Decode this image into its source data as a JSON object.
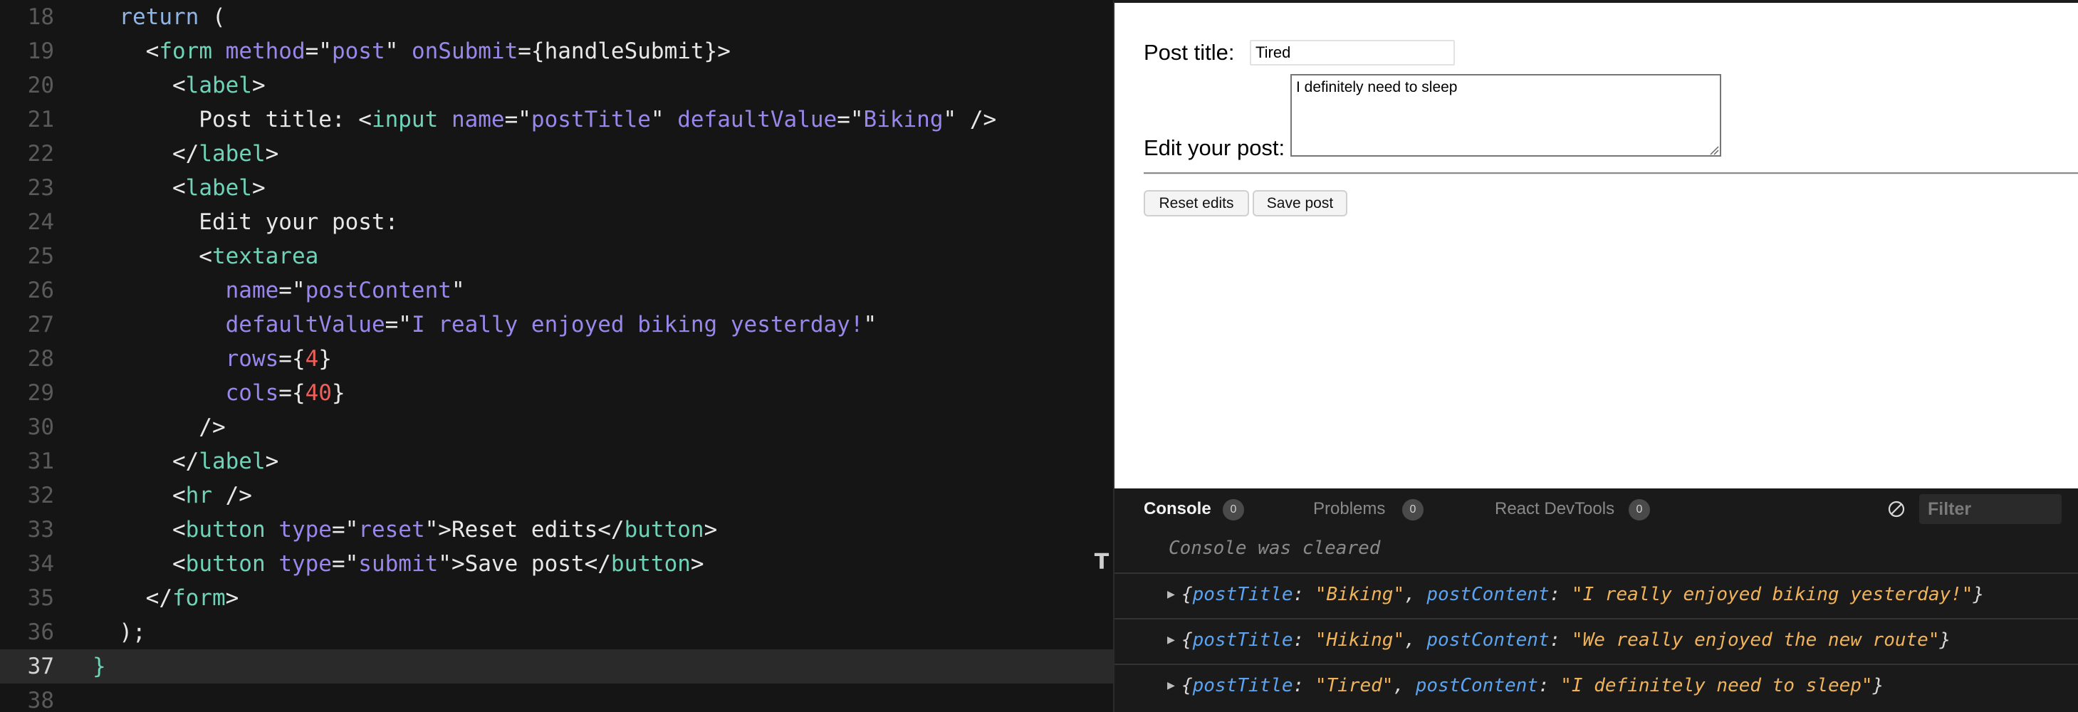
{
  "editor": {
    "lines": [
      {
        "num": "18",
        "tokens": [
          {
            "t": "  ",
            "c": "t-text"
          },
          {
            "t": "return",
            "c": "t-kw"
          },
          {
            "t": " (",
            "c": "t-punc"
          }
        ]
      },
      {
        "num": "19",
        "tokens": [
          {
            "t": "    <",
            "c": "t-punc"
          },
          {
            "t": "form",
            "c": "t-tag"
          },
          {
            "t": " ",
            "c": "t-text"
          },
          {
            "t": "method",
            "c": "t-attr"
          },
          {
            "t": "=\"",
            "c": "t-punc"
          },
          {
            "t": "post",
            "c": "t-str"
          },
          {
            "t": "\" ",
            "c": "t-punc"
          },
          {
            "t": "onSubmit",
            "c": "t-attr"
          },
          {
            "t": "={handleSubmit}>",
            "c": "t-punc"
          }
        ]
      },
      {
        "num": "20",
        "tokens": [
          {
            "t": "      <",
            "c": "t-punc"
          },
          {
            "t": "label",
            "c": "t-tag"
          },
          {
            "t": ">",
            "c": "t-punc"
          }
        ]
      },
      {
        "num": "21",
        "tokens": [
          {
            "t": "        Post title: <",
            "c": "t-text"
          },
          {
            "t": "input",
            "c": "t-tag"
          },
          {
            "t": " ",
            "c": "t-text"
          },
          {
            "t": "name",
            "c": "t-attr"
          },
          {
            "t": "=\"",
            "c": "t-punc"
          },
          {
            "t": "postTitle",
            "c": "t-str"
          },
          {
            "t": "\" ",
            "c": "t-punc"
          },
          {
            "t": "defaultValue",
            "c": "t-attr"
          },
          {
            "t": "=\"",
            "c": "t-punc"
          },
          {
            "t": "Biking",
            "c": "t-str"
          },
          {
            "t": "\" />",
            "c": "t-punc"
          }
        ]
      },
      {
        "num": "22",
        "tokens": [
          {
            "t": "      </",
            "c": "t-punc"
          },
          {
            "t": "label",
            "c": "t-tag"
          },
          {
            "t": ">",
            "c": "t-punc"
          }
        ]
      },
      {
        "num": "23",
        "tokens": [
          {
            "t": "      <",
            "c": "t-punc"
          },
          {
            "t": "label",
            "c": "t-tag"
          },
          {
            "t": ">",
            "c": "t-punc"
          }
        ]
      },
      {
        "num": "24",
        "tokens": [
          {
            "t": "        Edit your post:",
            "c": "t-text"
          }
        ]
      },
      {
        "num": "25",
        "tokens": [
          {
            "t": "        <",
            "c": "t-punc"
          },
          {
            "t": "textarea",
            "c": "t-tag"
          }
        ]
      },
      {
        "num": "26",
        "tokens": [
          {
            "t": "          ",
            "c": "t-text"
          },
          {
            "t": "name",
            "c": "t-attr"
          },
          {
            "t": "=\"",
            "c": "t-punc"
          },
          {
            "t": "postContent",
            "c": "t-str"
          },
          {
            "t": "\"",
            "c": "t-punc"
          }
        ]
      },
      {
        "num": "27",
        "tokens": [
          {
            "t": "          ",
            "c": "t-text"
          },
          {
            "t": "defaultValue",
            "c": "t-attr"
          },
          {
            "t": "=\"",
            "c": "t-punc"
          },
          {
            "t": "I really enjoyed biking yesterday!",
            "c": "t-str"
          },
          {
            "t": "\"",
            "c": "t-punc"
          }
        ]
      },
      {
        "num": "28",
        "tokens": [
          {
            "t": "          ",
            "c": "t-text"
          },
          {
            "t": "rows",
            "c": "t-attr"
          },
          {
            "t": "={",
            "c": "t-punc"
          },
          {
            "t": "4",
            "c": "t-num"
          },
          {
            "t": "}",
            "c": "t-punc"
          }
        ]
      },
      {
        "num": "29",
        "tokens": [
          {
            "t": "          ",
            "c": "t-text"
          },
          {
            "t": "cols",
            "c": "t-attr"
          },
          {
            "t": "={",
            "c": "t-punc"
          },
          {
            "t": "40",
            "c": "t-num"
          },
          {
            "t": "}",
            "c": "t-punc"
          }
        ]
      },
      {
        "num": "30",
        "tokens": [
          {
            "t": "        />",
            "c": "t-punc"
          }
        ]
      },
      {
        "num": "31",
        "tokens": [
          {
            "t": "      </",
            "c": "t-punc"
          },
          {
            "t": "label",
            "c": "t-tag"
          },
          {
            "t": ">",
            "c": "t-punc"
          }
        ]
      },
      {
        "num": "32",
        "tokens": [
          {
            "t": "      <",
            "c": "t-punc"
          },
          {
            "t": "hr",
            "c": "t-tag"
          },
          {
            "t": " />",
            "c": "t-punc"
          }
        ]
      },
      {
        "num": "33",
        "tokens": [
          {
            "t": "      <",
            "c": "t-punc"
          },
          {
            "t": "button",
            "c": "t-tag"
          },
          {
            "t": " ",
            "c": "t-text"
          },
          {
            "t": "type",
            "c": "t-attr"
          },
          {
            "t": "=\"",
            "c": "t-punc"
          },
          {
            "t": "reset",
            "c": "t-str"
          },
          {
            "t": "\">Reset edits</",
            "c": "t-punc"
          },
          {
            "t": "button",
            "c": "t-tag"
          },
          {
            "t": ">",
            "c": "t-punc"
          }
        ]
      },
      {
        "num": "34",
        "tokens": [
          {
            "t": "      <",
            "c": "t-punc"
          },
          {
            "t": "button",
            "c": "t-tag"
          },
          {
            "t": " ",
            "c": "t-text"
          },
          {
            "t": "type",
            "c": "t-attr"
          },
          {
            "t": "=\"",
            "c": "t-punc"
          },
          {
            "t": "submit",
            "c": "t-str"
          },
          {
            "t": "\">Save post</",
            "c": "t-punc"
          },
          {
            "t": "button",
            "c": "t-tag"
          },
          {
            "t": ">",
            "c": "t-punc"
          }
        ]
      },
      {
        "num": "35",
        "tokens": [
          {
            "t": "    </",
            "c": "t-punc"
          },
          {
            "t": "form",
            "c": "t-tag"
          },
          {
            "t": ">",
            "c": "t-punc"
          }
        ]
      },
      {
        "num": "36",
        "tokens": [
          {
            "t": "  );",
            "c": "t-punc"
          }
        ]
      },
      {
        "num": "37",
        "active": true,
        "tokens": [
          {
            "t": "}",
            "c": "t-brace"
          }
        ]
      },
      {
        "num": "38",
        "tokens": []
      }
    ]
  },
  "preview": {
    "title_label": "Post title:",
    "title_value": "Tired",
    "content_label": "Edit your post:",
    "content_value": "I definitely need to sleep",
    "reset_label": "Reset edits",
    "save_label": "Save post"
  },
  "devtools": {
    "tabs": [
      {
        "label": "Console",
        "count": "0",
        "active": true
      },
      {
        "label": "Problems",
        "count": "0",
        "active": false
      },
      {
        "label": "React DevTools",
        "count": "0",
        "active": false
      }
    ],
    "filter_placeholder": "Filter",
    "cleared_message": "Console was cleared",
    "logs": [
      {
        "title": "Biking",
        "content": "I really enjoyed biking yesterday!"
      },
      {
        "title": "Hiking",
        "content": "We really enjoyed the new route"
      },
      {
        "title": "Tired",
        "content": "I definitely need to sleep"
      }
    ]
  }
}
